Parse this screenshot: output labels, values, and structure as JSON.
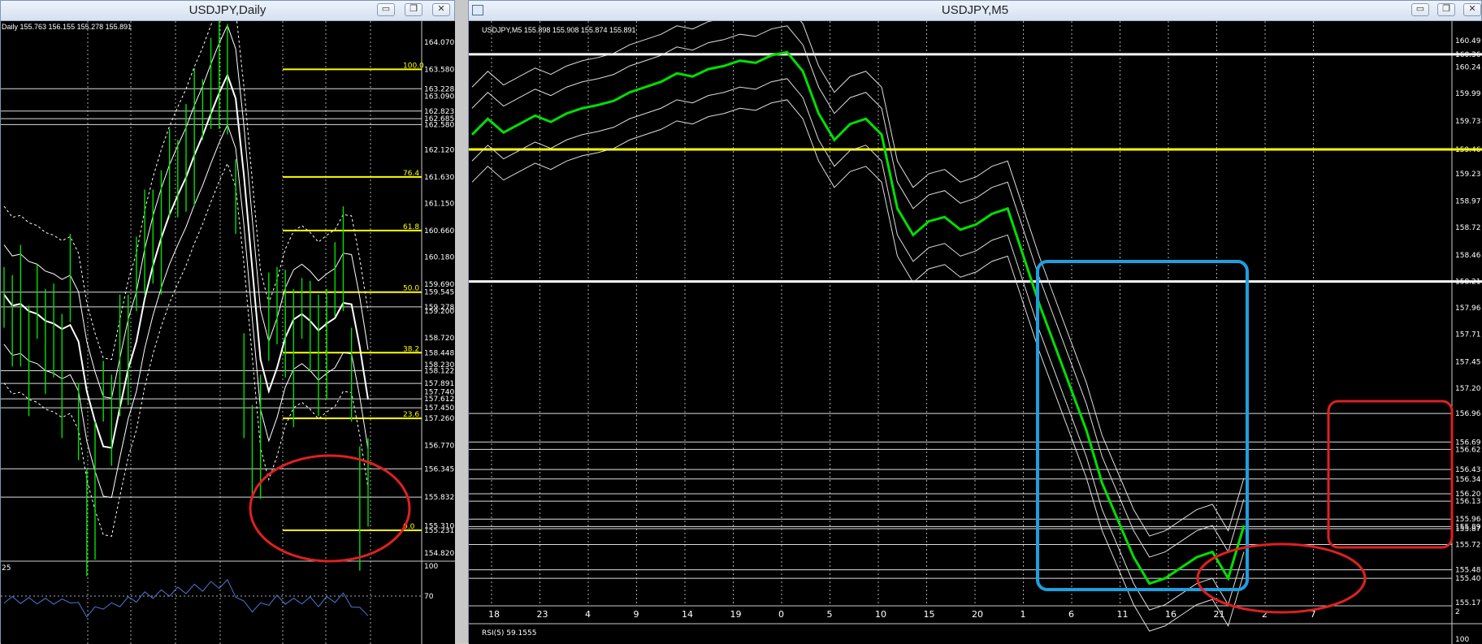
{
  "left_window": {
    "title": "USDJPY,Daily",
    "info": "Daily  155.763 156.155 155.278 155.891",
    "price_labels": [
      "164.070",
      "163.580",
      "163.228",
      "163.090",
      "162.823",
      "162.685",
      "162.580",
      "162.120",
      "161.630",
      "161.150",
      "160.660",
      "160.180",
      "159.690",
      "159.545",
      "159.278",
      "159.200",
      "158.720",
      "158.448",
      "158.230",
      "158.122",
      "157.891",
      "157.740",
      "157.612",
      "157.450",
      "157.260",
      "156.770",
      "156.345",
      "155.832",
      "155.310",
      "155.231",
      "154.820"
    ],
    "fib_levels": [
      "100.0",
      "76.4",
      "61.8",
      "50.0",
      "38.2",
      "23.6",
      "0.0"
    ],
    "rsi_labels": {
      "top": "100",
      "mid": "70",
      "left": "25"
    }
  },
  "right_window": {
    "title": "USDJPY,M5",
    "info": "USDJPY,M5  155.898 155.908 155.874 155.891",
    "price_labels": [
      "160.49",
      "160.36",
      "160.24",
      "159.99",
      "159.73",
      "159.46",
      "159.23",
      "158.97",
      "158.72",
      "158.46",
      "158.21",
      "157.96",
      "157.71",
      "157.45",
      "157.20",
      "156.96",
      "156.69",
      "156.62",
      "156.43",
      "156.34",
      "156.20",
      "156.13",
      "155.96",
      "155.89",
      "155.87",
      "155.72",
      "155.48",
      "155.40",
      "155.17"
    ],
    "x_ticks": [
      "18",
      "23",
      "4",
      "9",
      "14",
      "19",
      "0",
      "5",
      "10",
      "15",
      "20",
      "1",
      "6",
      "11",
      "16",
      "21",
      "2",
      "7"
    ],
    "rsi_info": "RSI(5) 59.1555",
    "rsi_labels": {
      "top": "2",
      "bot": "100"
    }
  },
  "colors": {
    "price": "#00e000",
    "band": "#ffffff",
    "fib": "#ffff00",
    "rsi": "#4a7ad8",
    "blue_box": "#1e9fe0",
    "red_mark": "#e02020"
  },
  "chart_data": [
    {
      "type": "line",
      "title": "USDJPY,Daily",
      "ylim": [
        154.82,
        164.07
      ],
      "x": [
        0,
        1,
        2,
        3,
        4,
        5,
        6,
        7,
        8,
        9,
        10,
        11,
        12,
        13,
        14,
        15,
        16,
        17,
        18,
        19,
        20,
        21,
        22,
        23,
        24,
        25,
        26,
        27,
        28,
        29,
        30,
        31,
        32,
        33,
        34,
        35,
        36,
        37,
        38,
        39,
        40,
        41,
        42,
        43,
        44
      ],
      "series": [
        {
          "values": [
            159.5,
            159.1,
            159.4,
            158.8,
            159.3,
            158.6,
            159.2,
            158.4,
            159.6,
            157.4,
            155.6,
            156.2,
            157.8,
            157.3,
            158.5,
            159.0,
            159.8,
            160.4,
            160.9,
            161.0,
            161.5,
            161.8,
            162.2,
            162.6,
            162.9,
            163.4,
            163.7,
            163.9,
            161.2,
            157.8,
            157.0,
            157.3,
            158.9,
            159.5,
            159.2,
            158.6,
            159.3,
            159.0,
            158.5,
            159.1,
            159.7,
            160.1,
            158.4,
            156.0,
            155.9
          ]
        }
      ]
    },
    {
      "type": "line",
      "title": "USDJPY,M5",
      "ylim": [
        155.17,
        160.49
      ],
      "x": [
        0,
        1,
        2,
        3,
        4,
        5,
        6,
        7,
        8,
        9,
        10,
        11,
        12,
        13,
        14,
        15,
        16,
        17,
        18,
        19,
        20,
        21,
        22,
        23,
        24,
        25,
        26,
        27,
        28,
        29,
        30,
        31,
        32,
        33,
        34,
        35,
        36,
        37,
        38,
        39,
        40,
        41,
        42,
        43,
        44,
        45,
        46,
        47,
        48,
        49
      ],
      "series": [
        {
          "values": [
            159.6,
            159.75,
            159.62,
            159.7,
            159.78,
            159.72,
            159.8,
            159.85,
            159.88,
            159.92,
            160.0,
            160.05,
            160.1,
            160.18,
            160.15,
            160.22,
            160.25,
            160.3,
            160.28,
            160.35,
            160.38,
            160.2,
            159.8,
            159.55,
            159.7,
            159.75,
            159.6,
            158.9,
            158.65,
            158.78,
            158.82,
            158.7,
            158.75,
            158.85,
            158.9,
            158.45,
            158.0,
            157.6,
            157.2,
            156.8,
            156.3,
            155.95,
            155.6,
            155.35,
            155.4,
            155.5,
            155.6,
            155.65,
            155.4,
            155.9
          ]
        }
      ]
    }
  ]
}
